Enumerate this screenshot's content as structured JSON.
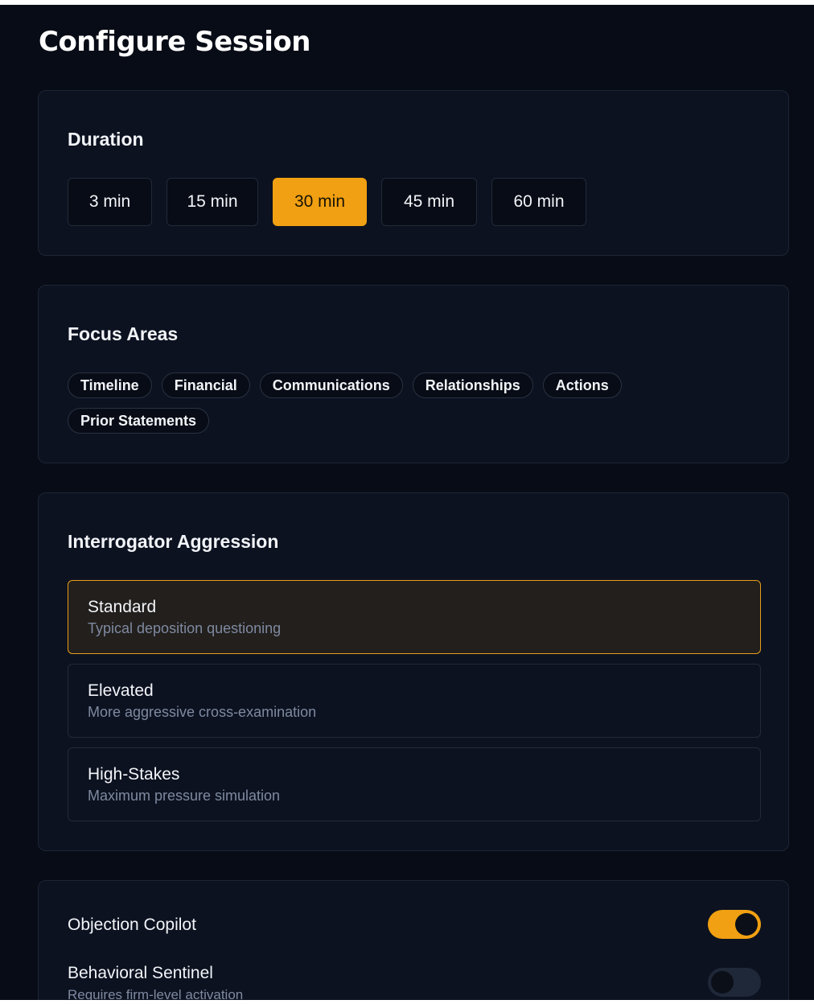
{
  "page": {
    "title": "Configure Session"
  },
  "duration": {
    "title": "Duration",
    "options": [
      "3 min",
      "15 min",
      "30 min",
      "45 min",
      "60 min"
    ],
    "selected": "30 min"
  },
  "focus_areas": {
    "title": "Focus Areas",
    "chips": [
      "Timeline",
      "Financial",
      "Communications",
      "Relationships",
      "Actions",
      "Prior Statements"
    ]
  },
  "aggression": {
    "title": "Interrogator Aggression",
    "options": [
      {
        "title": "Standard",
        "description": "Typical deposition questioning",
        "selected": true
      },
      {
        "title": "Elevated",
        "description": "More aggressive cross-examination",
        "selected": false
      },
      {
        "title": "High-Stakes",
        "description": "Maximum pressure simulation",
        "selected": false
      }
    ]
  },
  "toggles": [
    {
      "label": "Objection Copilot",
      "on": true
    },
    {
      "label": "Behavioral Sentinel",
      "sublabel": "Requires firm-level activation",
      "on": false
    }
  ],
  "colors": {
    "accent": "#f0a012",
    "background": "#080c16",
    "card": "#0c1220",
    "muted_text": "#7f8aa0"
  }
}
